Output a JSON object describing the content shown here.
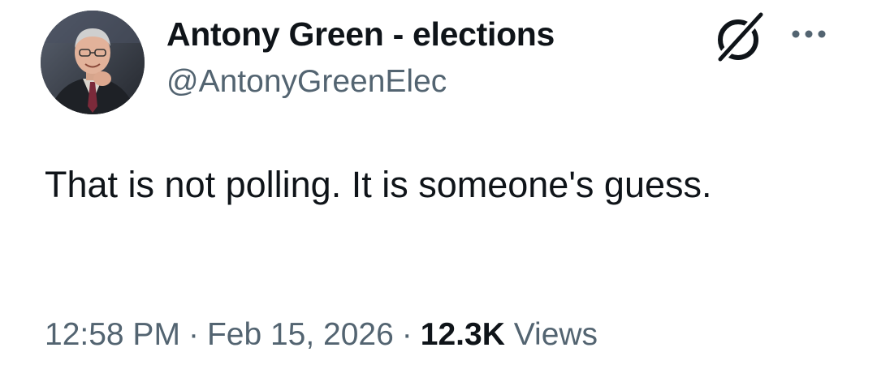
{
  "author": {
    "display_name": "Antony Green - elections",
    "handle": "@AntonyGreenElec",
    "avatar_icon": "profile-photo"
  },
  "header_actions": {
    "grok_icon": "grok-slash-circle-icon",
    "more_icon": "more-dots-icon"
  },
  "tweet": {
    "text": "That is not polling. It is someone's guess."
  },
  "meta": {
    "time": "12:58 PM",
    "separator": "·",
    "date": "Feb 15, 2026",
    "views_count": "12.3K",
    "views_label": "Views"
  },
  "colors": {
    "text_primary": "#0f1419",
    "text_secondary": "#536471",
    "background": "#ffffff"
  }
}
